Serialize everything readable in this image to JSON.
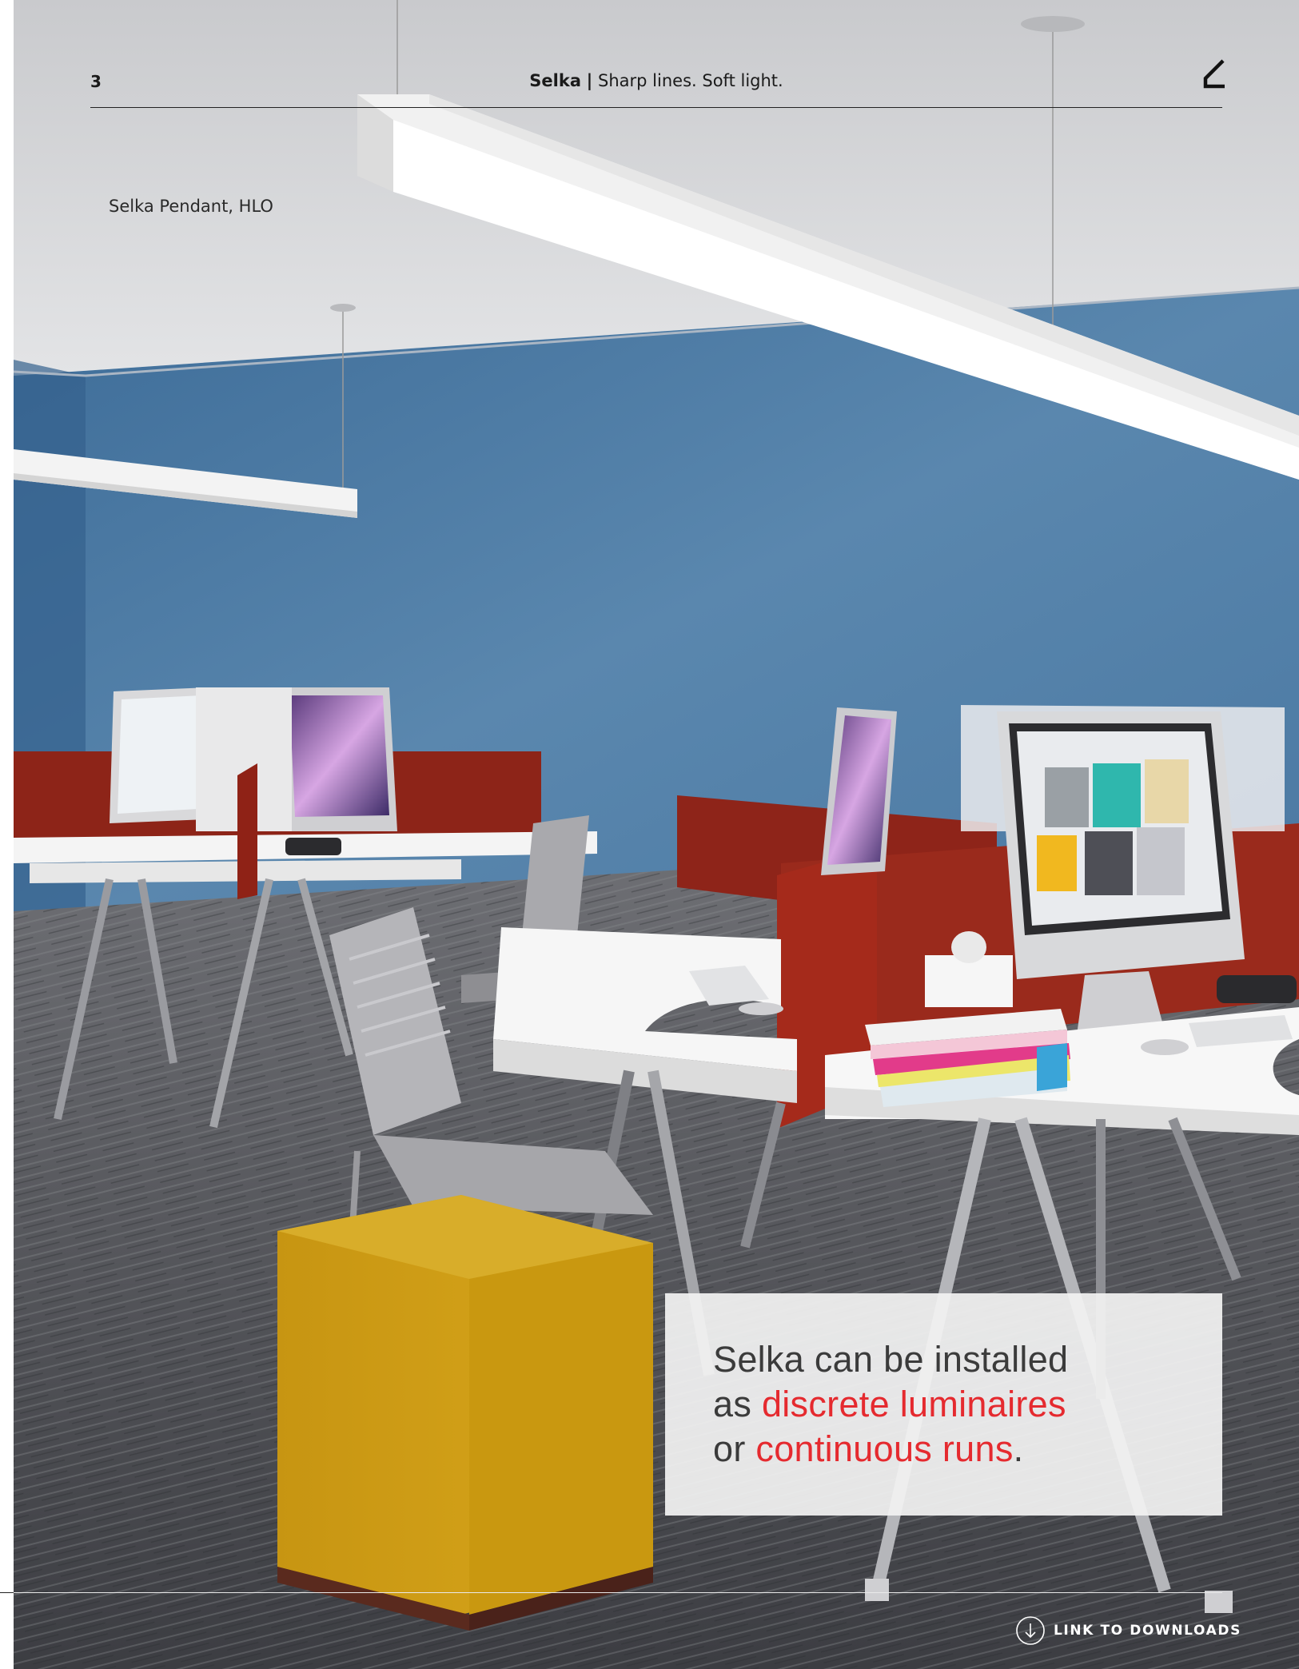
{
  "header": {
    "page_number": "3",
    "brand": "Selka",
    "separator": "|",
    "tagline": "Sharp lines. Soft light."
  },
  "caption": "Selka Pendant, HLO",
  "quote": {
    "line1": "Selka can be installed",
    "line2_prefix": "as ",
    "line2_highlight": "discrete luminaires",
    "line3_prefix": "or ",
    "line3_highlight": "continuous runs",
    "line3_suffix": "."
  },
  "footer": {
    "downloads_label": "LINK TO DOWNLOADS"
  },
  "colors": {
    "accent": "#e52a2f",
    "wall": "#4f7fa8",
    "ceiling": "#cfd0d4",
    "panel": "#8e2318",
    "ottoman": "#d2a013"
  },
  "icons": {
    "logo": "logo-mark",
    "downloads": "arrow-down-circle-icon"
  }
}
